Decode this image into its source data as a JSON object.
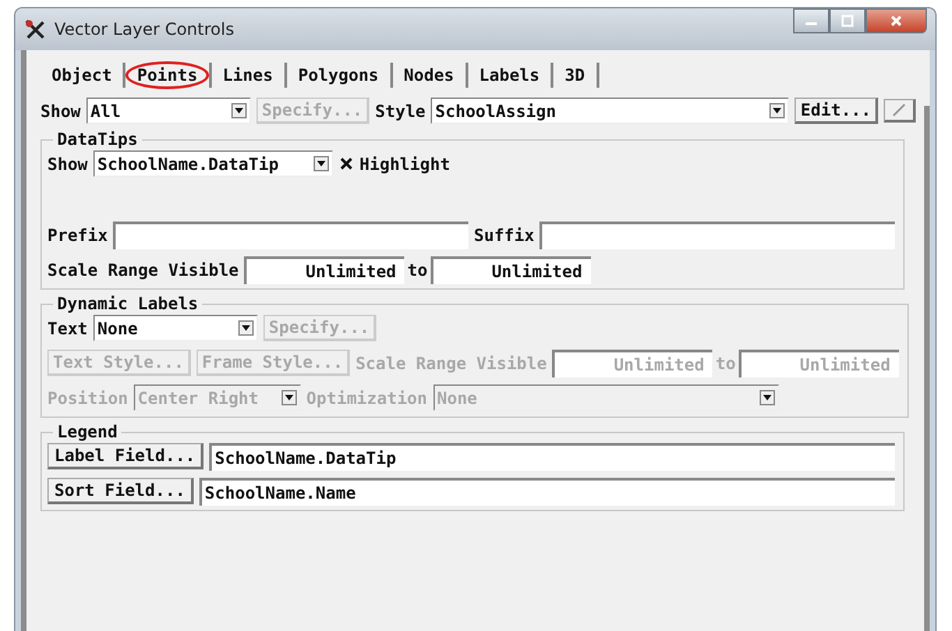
{
  "window": {
    "title": "Vector Layer Controls"
  },
  "tabs": [
    {
      "label": "Object",
      "selected": false
    },
    {
      "label": "Points",
      "selected": true
    },
    {
      "label": "Lines",
      "selected": false
    },
    {
      "label": "Polygons",
      "selected": false
    },
    {
      "label": "Nodes",
      "selected": false
    },
    {
      "label": "Labels",
      "selected": false
    },
    {
      "label": "3D",
      "selected": false
    }
  ],
  "top_row": {
    "show": {
      "label": "Show",
      "value": "All"
    },
    "specify": {
      "label": "Specify...",
      "disabled": true
    },
    "style": {
      "label": "Style",
      "value": "SchoolAssign"
    },
    "edit": {
      "label": "Edit...",
      "disabled": false
    }
  },
  "datatips": {
    "title": "DataTips",
    "show": {
      "label": "Show",
      "value": "SchoolName.DataTip"
    },
    "highlight": {
      "label": "Highlight",
      "checked": true
    },
    "prefix": {
      "label": "Prefix"
    },
    "suffix": {
      "label": "Suffix"
    },
    "scale_range": {
      "label": "Scale Range Visible",
      "from": "Unlimited",
      "to_label": "to",
      "to": "Unlimited",
      "disabled": false
    }
  },
  "dynamic_labels": {
    "title": "Dynamic Labels",
    "text": {
      "label": "Text",
      "value": "None",
      "disabled": false
    },
    "specify": {
      "label": "Specify...",
      "disabled": true
    },
    "text_style": {
      "label": "Text Style...",
      "disabled": true
    },
    "frame_style": {
      "label": "Frame Style...",
      "disabled": true
    },
    "scale_range": {
      "label": "Scale Range Visible",
      "from": "Unlimited",
      "to_label": "to",
      "to": "Unlimited",
      "disabled": true
    },
    "position": {
      "label": "Position",
      "value": "Center Right",
      "disabled": true
    },
    "optimization": {
      "label": "Optimization",
      "value": "None",
      "disabled": true
    }
  },
  "legend": {
    "title": "Legend",
    "label_field": {
      "button": "Label Field...",
      "value": "SchoolName.DataTip"
    },
    "sort_field": {
      "button": "Sort Field...",
      "value": "SchoolName.Name"
    }
  }
}
